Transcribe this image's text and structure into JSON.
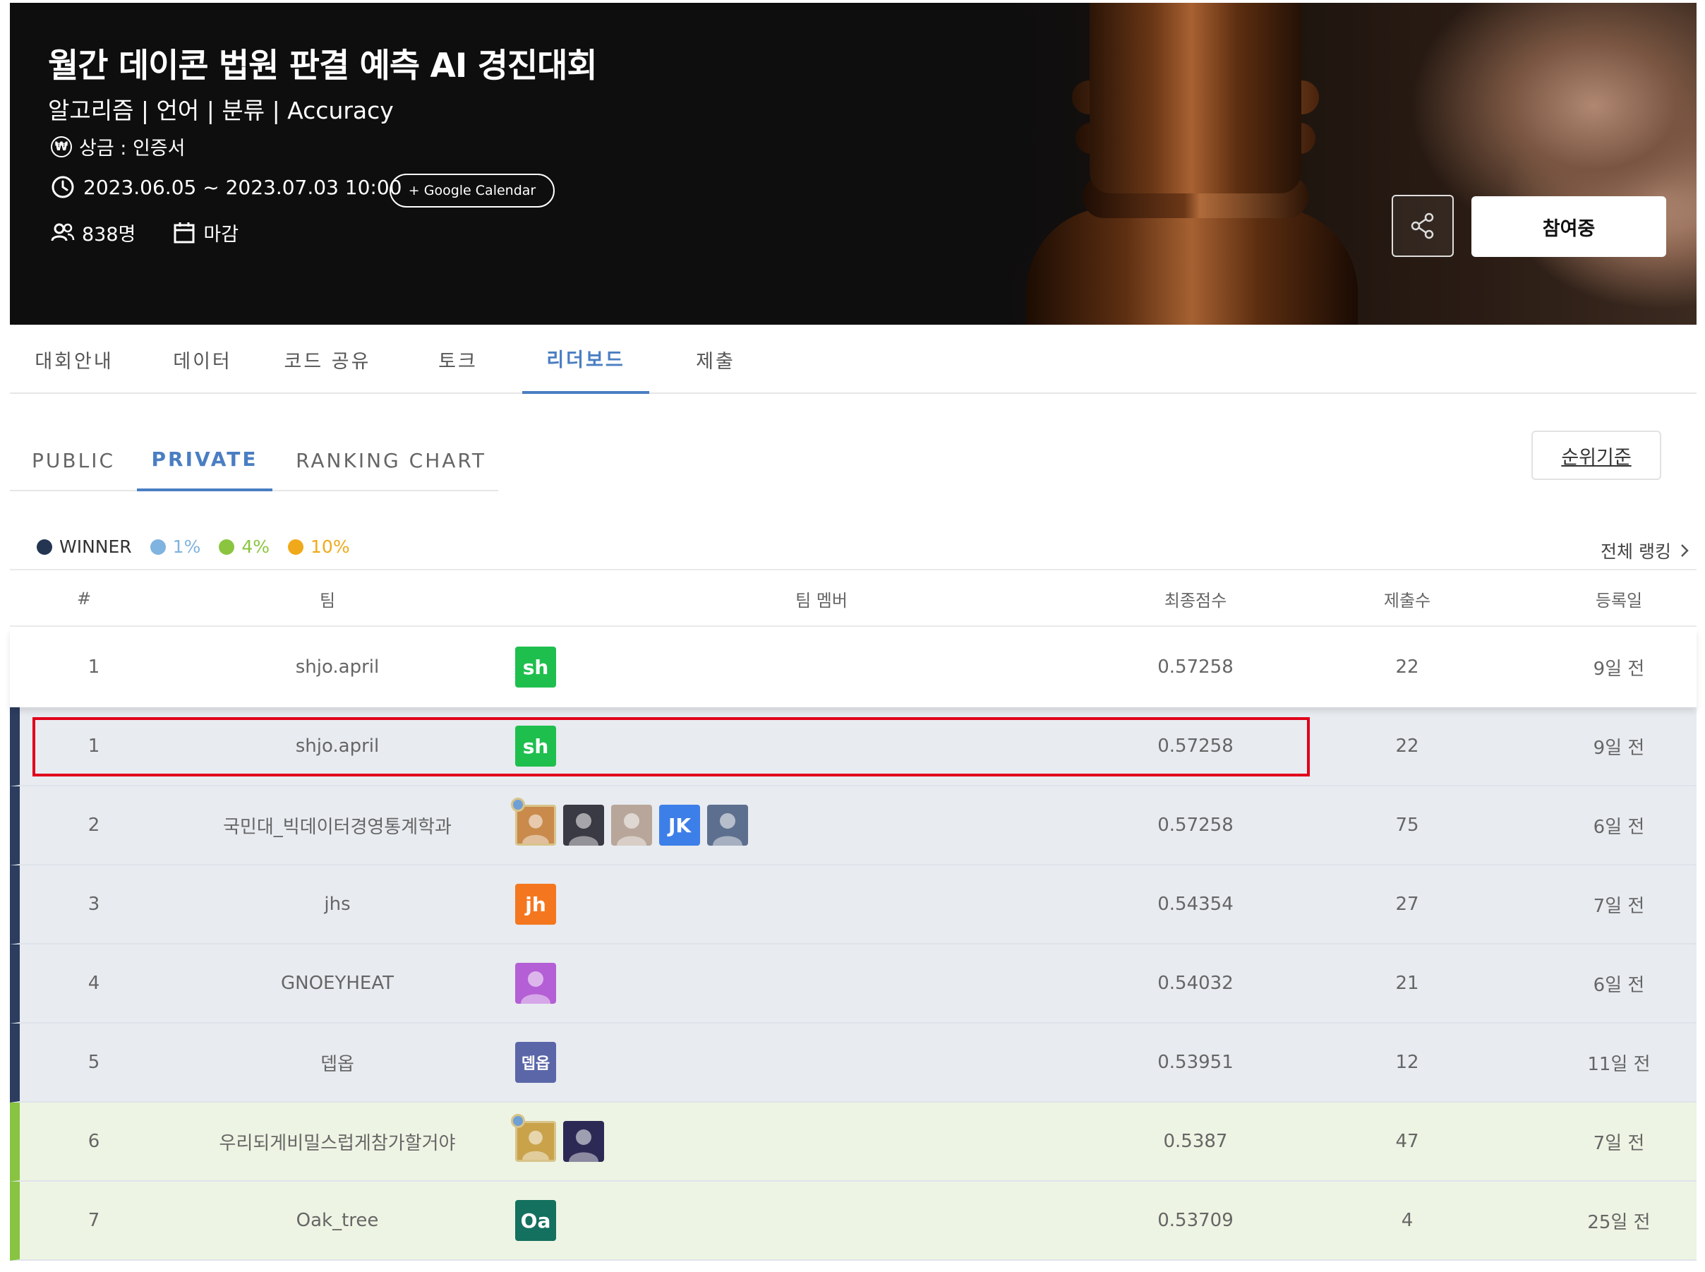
{
  "hero": {
    "title": "월간 데이콘 법원 판결 예측 AI 경진대회",
    "tags": "알고리즘 | 언어 | 분류 | Accuracy",
    "prize": "상금 : 인증서",
    "won_symbol": "₩",
    "period": "2023.06.05 ~ 2023.07.03 10:00",
    "google_calendar": "+ Google Calendar",
    "participants": "838명",
    "status": "마감",
    "join_label": "참여중"
  },
  "main_tabs": [
    "대회안내",
    "데이터",
    "코드 공유",
    "토크",
    "리더보드",
    "제출"
  ],
  "main_tab_active": "리더보드",
  "sub_tabs": [
    "PUBLIC",
    "PRIVATE",
    "RANKING CHART"
  ],
  "sub_tab_active": "PRIVATE",
  "criteria_label": "순위기준",
  "legend": [
    {
      "label": "WINNER",
      "color": "#243552"
    },
    {
      "label": "1%",
      "color": "#7fb3e0"
    },
    {
      "label": "4%",
      "color": "#8bc53f"
    },
    {
      "label": "10%",
      "color": "#f0a91a"
    }
  ],
  "full_ranking_label": "전체 랭킹",
  "table": {
    "headers": {
      "rank": "#",
      "team": "팀",
      "members": "팀 멤버",
      "score": "최종점수",
      "submissions": "제출수",
      "date": "등록일"
    },
    "my_row": {
      "rank": "1",
      "team": "shjo.april",
      "score": "0.57258",
      "submissions": "22",
      "date": "9일 전",
      "avatars": [
        {
          "text": "sh",
          "color": "#1fbf4e"
        }
      ]
    },
    "rows": [
      {
        "rank": "1",
        "team": "shjo.april",
        "score": "0.57258",
        "submissions": "22",
        "date": "9일 전",
        "tier": "winner",
        "avatars": [
          {
            "text": "sh",
            "color": "#1fbf4e"
          }
        ]
      },
      {
        "rank": "2",
        "team": "국민대_빅데이터경영통계학과",
        "score": "0.57258",
        "submissions": "75",
        "date": "6일 전",
        "tier": "winner",
        "avatars": [
          {
            "text": "",
            "color": "#c98a4b",
            "leader": true
          },
          {
            "text": "",
            "color": "#3a3a44"
          },
          {
            "text": "",
            "color": "#b8a69a"
          },
          {
            "text": "JK",
            "color": "#3d7fe8"
          },
          {
            "text": "",
            "color": "#5d6f8e"
          }
        ]
      },
      {
        "rank": "3",
        "team": "jhs",
        "score": "0.54354",
        "submissions": "27",
        "date": "7일 전",
        "tier": "winner",
        "avatars": [
          {
            "text": "jh",
            "color": "#f4771f"
          }
        ]
      },
      {
        "rank": "4",
        "team": "GNOEYHEAT",
        "score": "0.54032",
        "submissions": "21",
        "date": "6일 전",
        "tier": "winner",
        "avatars": [
          {
            "text": "",
            "color": "#b45fd6"
          }
        ]
      },
      {
        "rank": "5",
        "team": "뎁옵",
        "score": "0.53951",
        "submissions": "12",
        "date": "11일 전",
        "tier": "winner",
        "avatars": [
          {
            "text": "뎁옵",
            "color": "#5a66a8"
          }
        ]
      },
      {
        "rank": "6",
        "team": "우리되게비밀스럽게참가할거야",
        "score": "0.5387",
        "submissions": "47",
        "date": "7일 전",
        "tier": "pct4",
        "avatars": [
          {
            "text": "",
            "color": "#c9a24a",
            "leader": true
          },
          {
            "text": "",
            "color": "#2c2a55"
          }
        ]
      },
      {
        "rank": "7",
        "team": "Oak_tree",
        "score": "0.53709",
        "submissions": "4",
        "date": "25일 전",
        "tier": "pct4",
        "avatars": [
          {
            "text": "Oa",
            "color": "#14705f"
          }
        ]
      }
    ]
  }
}
